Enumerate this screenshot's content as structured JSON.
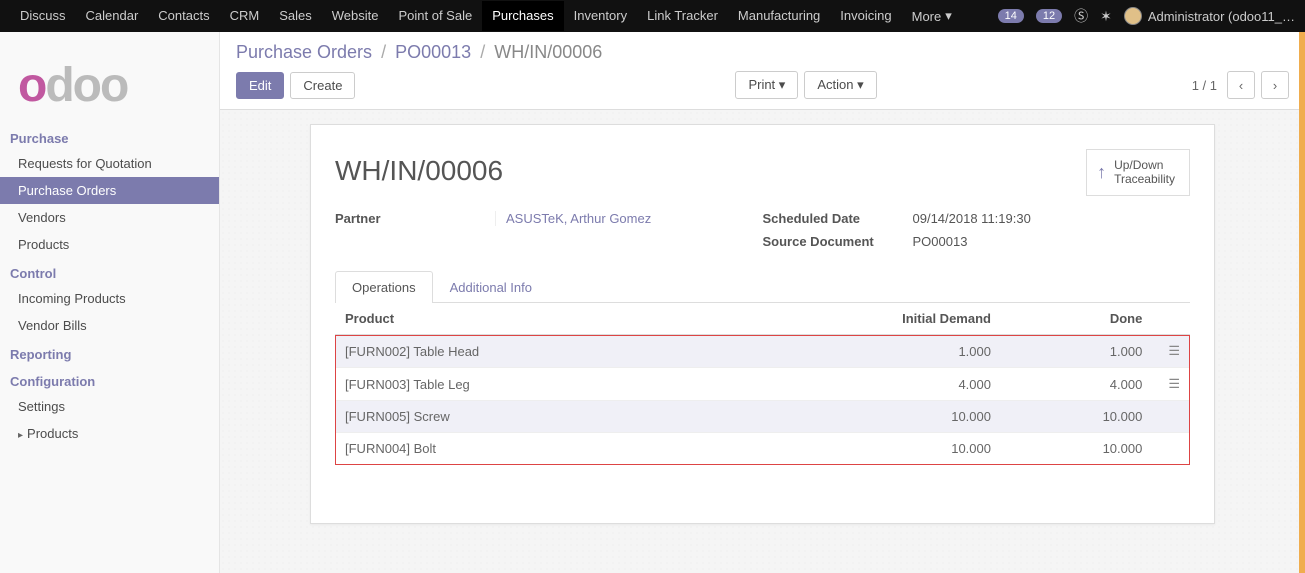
{
  "nav": {
    "items": [
      "Discuss",
      "Calendar",
      "Contacts",
      "CRM",
      "Sales",
      "Website",
      "Point of Sale",
      "Purchases",
      "Inventory",
      "Link Tracker",
      "Manufacturing",
      "Invoicing"
    ],
    "active": "Purchases",
    "more": "More",
    "badge1": "14",
    "badge2": "12",
    "user": "Administrator (odoo11_…"
  },
  "sidebar": {
    "sections": [
      {
        "title": "Purchase",
        "items": [
          "Requests for Quotation",
          "Purchase Orders",
          "Vendors",
          "Products"
        ],
        "active": "Purchase Orders"
      },
      {
        "title": "Control",
        "items": [
          "Incoming Products",
          "Vendor Bills"
        ]
      },
      {
        "title": "Reporting",
        "items": []
      },
      {
        "title": "Configuration",
        "items": [
          "Settings",
          "Products"
        ]
      }
    ]
  },
  "breadcrumb": {
    "root": "Purchase Orders",
    "parent": "PO00013",
    "current": "WH/IN/00006"
  },
  "buttons": {
    "edit": "Edit",
    "create": "Create",
    "print": "Print",
    "action": "Action"
  },
  "pager": {
    "range": "1 / 1"
  },
  "form": {
    "title": "WH/IN/00006",
    "stat": {
      "l1": "Up/Down",
      "l2": "Traceability"
    },
    "partner_label": "Partner",
    "partner_value": "ASUSTeK, Arthur Gomez",
    "sched_label": "Scheduled Date",
    "sched_value": "09/14/2018 11:19:30",
    "source_label": "Source Document",
    "source_value": "PO00013"
  },
  "tabs": {
    "t1": "Operations",
    "t2": "Additional Info"
  },
  "table": {
    "h_product": "Product",
    "h_demand": "Initial Demand",
    "h_done": "Done",
    "rows": [
      {
        "product": "[FURN002] Table Head",
        "demand": "1.000",
        "done": "1.000",
        "icon": true
      },
      {
        "product": "[FURN003] Table Leg",
        "demand": "4.000",
        "done": "4.000",
        "icon": true
      },
      {
        "product": "[FURN005] Screw",
        "demand": "10.000",
        "done": "10.000",
        "icon": false
      },
      {
        "product": "[FURN004] Bolt",
        "demand": "10.000",
        "done": "10.000",
        "icon": false
      }
    ]
  }
}
